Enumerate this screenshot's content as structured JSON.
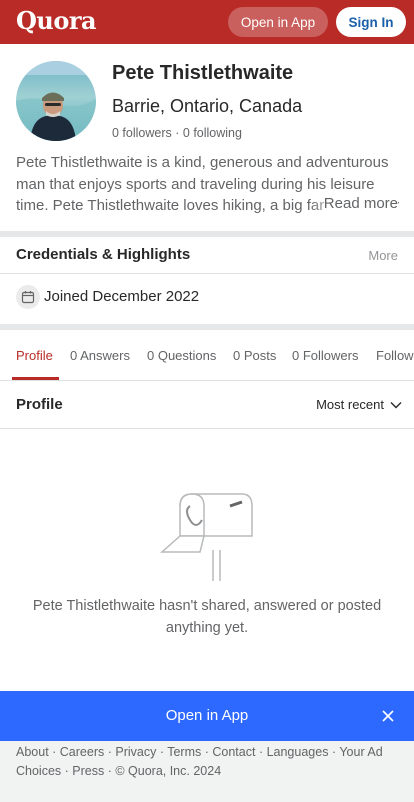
{
  "topbar": {
    "logo": "Quora",
    "open_in_app": "Open in App",
    "sign_in": "Sign In"
  },
  "profile": {
    "name": "Pete Thistlethwaite",
    "location": "Barrie, Ontario, Canada",
    "followers": "0 followers",
    "separator": "·",
    "following": "0 following",
    "bio": "Pete Thistlethwaite is a kind, generous and adventurous man that enjoys sports and traveling during his leisure time. Pete Thistlethwaite loves hiking, a big fan of outdoor activities",
    "read_more": "Read more"
  },
  "credentials": {
    "title": "Credentials & Highlights",
    "more": "More",
    "joined": "Joined December 2022",
    "joined_icon": "calendar-icon"
  },
  "tabs": [
    {
      "label": "Profile",
      "active": true
    },
    {
      "label": "0 Answers",
      "active": false
    },
    {
      "label": "0 Questions",
      "active": false
    },
    {
      "label": "0 Posts",
      "active": false
    },
    {
      "label": "0 Followers",
      "active": false
    },
    {
      "label": "Following",
      "active": false
    }
  ],
  "content": {
    "section_title": "Profile",
    "sort_label": "Most recent",
    "empty_message": "Pete Thistlethwaite hasn't shared, answered or posted anything yet.",
    "empty_icon": "mailbox-icon"
  },
  "app_banner": {
    "label": "Open in App",
    "close_icon": "close-icon"
  },
  "footer": {
    "links": [
      "About",
      "Careers",
      "Privacy",
      "Terms",
      "Contact",
      "Languages",
      "Your Ad Choices",
      "Press"
    ],
    "copyright": "© Quora, Inc. 2024"
  },
  "colors": {
    "brand": "#b92b27",
    "link_blue": "#195faa",
    "banner_blue": "#2e69ff",
    "text_primary": "#282829",
    "text_secondary": "#636466"
  }
}
